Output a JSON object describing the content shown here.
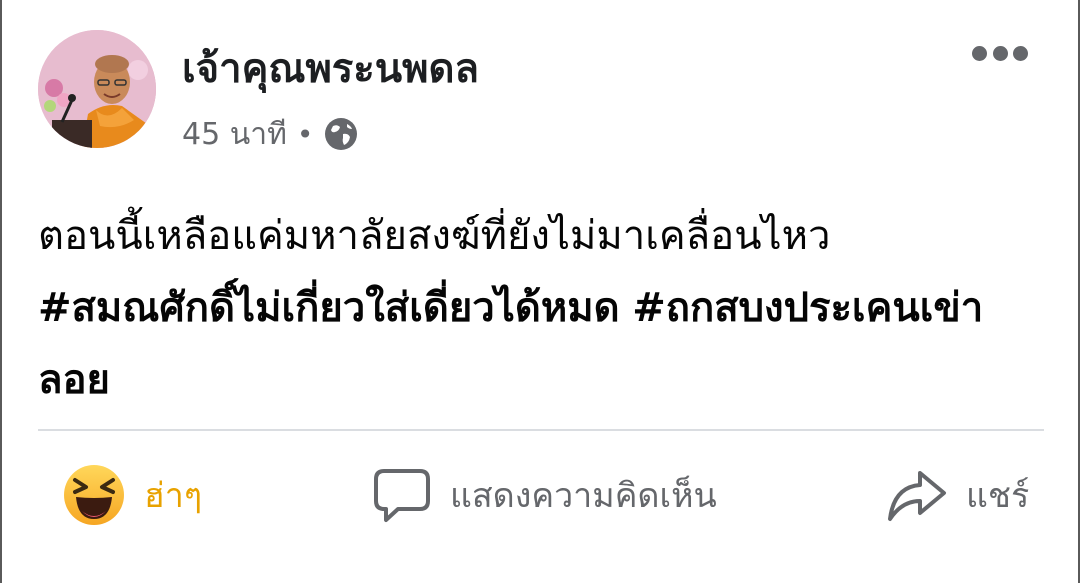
{
  "post": {
    "author": "เจ้าคุณพระนพดล",
    "time": "45 นาที",
    "separator": "•",
    "body": {
      "line1": "ตอนนี้เหลือแค่มหาลัยสงฆ์ที่ยังไม่มาเคลื่อนไหว",
      "hashtag1": "#สมณศักดิ์ไม่เกี่ยวใส่เดี่ยวได้หมด",
      "hashtag2": "#ถกสบงประเคนเข่าลอย"
    }
  },
  "actions": {
    "reaction_label": "ฮ่าๆ",
    "comment_label": "แสดงความคิดเห็น",
    "share_label": "แชร์"
  },
  "icons": {
    "more": "more-horizontal-icon",
    "privacy": "globe-icon",
    "reaction": "haha-emoji-icon",
    "comment": "comment-bubble-icon",
    "share": "share-arrow-icon"
  },
  "colors": {
    "reaction_active": "#e8a200",
    "secondary_text": "#65676b",
    "primary_text": "#050505",
    "divider": "#dadde1"
  }
}
